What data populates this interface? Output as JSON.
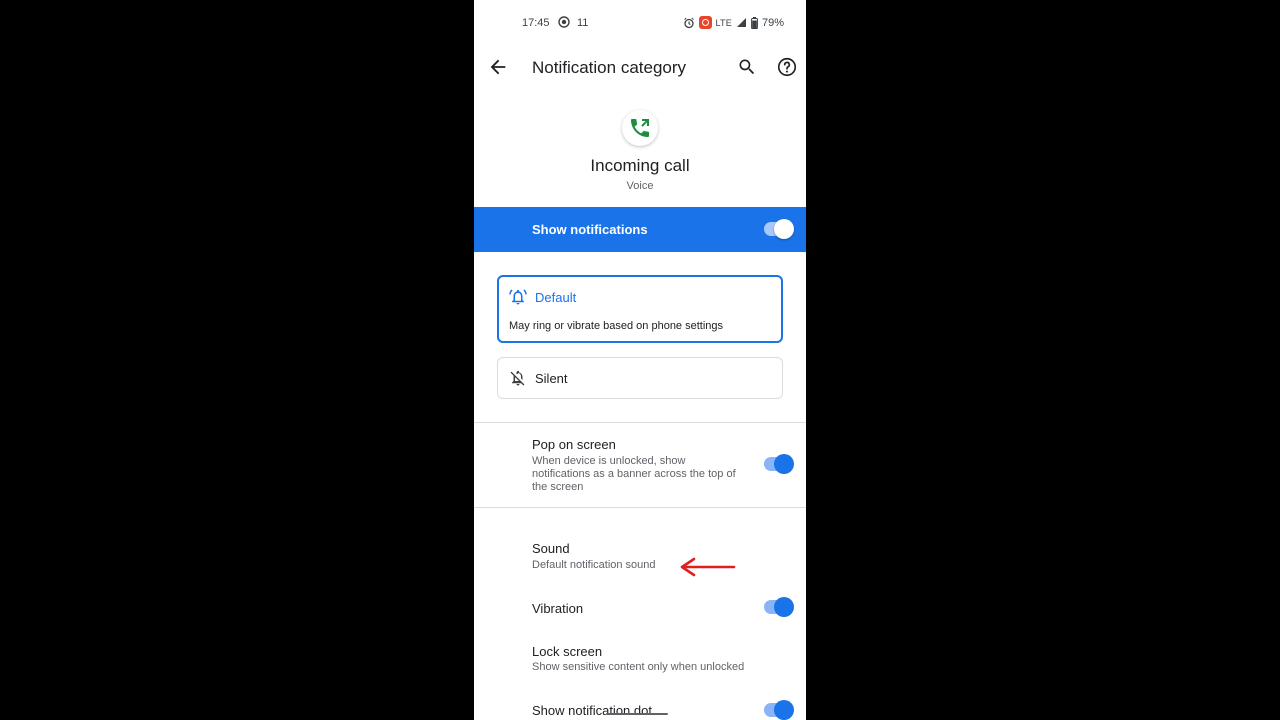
{
  "status_bar": {
    "time": "17:45",
    "count": "11",
    "network": "LTE",
    "battery": "79%"
  },
  "top_bar": {
    "title": "Notification category"
  },
  "header": {
    "channel_name": "Incoming call",
    "app_name": "Voice"
  },
  "master_switch": {
    "label": "Show notifications",
    "checked": true
  },
  "modes": {
    "default": {
      "title": "Default",
      "description": "May ring or vibrate based on phone settings",
      "selected": true
    },
    "silent": {
      "title": "Silent",
      "selected": false
    }
  },
  "settings": {
    "pop_on_screen": {
      "title": "Pop on screen",
      "summary": "When device is unlocked, show notifications as a banner across the top of the screen",
      "checked": true
    },
    "sound": {
      "title": "Sound",
      "summary": "Default notification sound"
    },
    "vibration": {
      "title": "Vibration",
      "checked": true
    },
    "lock_screen": {
      "title": "Lock screen",
      "summary": "Show sensitive content only when unlocked"
    },
    "notification_dot": {
      "title": "Show notification dot",
      "checked": true
    }
  },
  "colors": {
    "accent": "#1a73e8",
    "arrow": "#e02020",
    "phone_icon": "#1e8e3e"
  },
  "icons": {
    "back": "arrow-left-icon",
    "search": "search-icon",
    "help": "help-circle-icon",
    "app": "phone-call-icon",
    "default_mode": "bell-ring-icon",
    "silent_mode": "bell-off-icon"
  }
}
